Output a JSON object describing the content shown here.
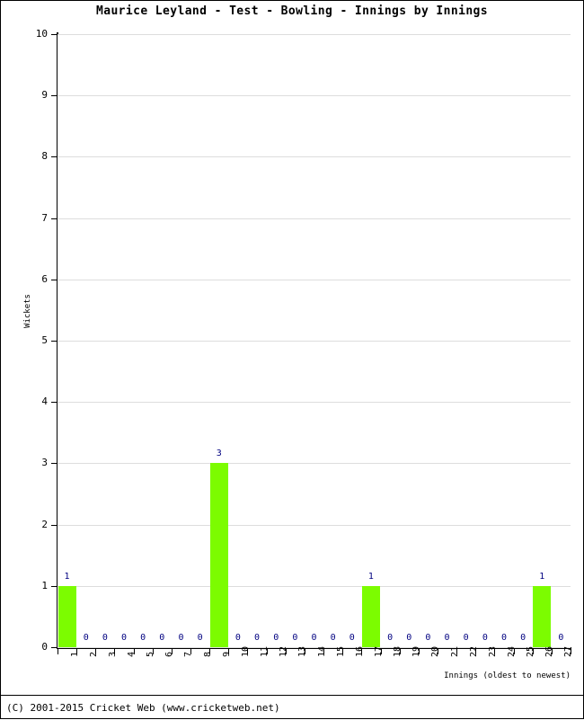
{
  "chart_data": {
    "type": "bar",
    "title": "Maurice Leyland - Test - Bowling - Innings by Innings",
    "xlabel": "Innings (oldest to newest)",
    "ylabel": "Wickets",
    "categories": [
      "1",
      "2",
      "3",
      "4",
      "5",
      "6",
      "7",
      "8",
      "9",
      "10",
      "11",
      "12",
      "13",
      "14",
      "15",
      "16",
      "17",
      "18",
      "19",
      "20",
      "21",
      "22",
      "23",
      "24",
      "25",
      "26",
      "27"
    ],
    "values": [
      1,
      0,
      0,
      0,
      0,
      0,
      0,
      0,
      3,
      0,
      0,
      0,
      0,
      0,
      0,
      0,
      1,
      0,
      0,
      0,
      0,
      0,
      0,
      0,
      0,
      1,
      0
    ],
    "point_labels": [
      "1",
      "0",
      "0",
      "0",
      "0",
      "0",
      "0",
      "0",
      "3",
      "0",
      "0",
      "0",
      "0",
      "0",
      "0",
      "0",
      "1",
      "0",
      "0",
      "0",
      "0",
      "0",
      "0",
      "0",
      "0",
      "1",
      "0"
    ],
    "ylim": [
      0,
      10
    ],
    "yticks": [
      0,
      1,
      2,
      3,
      4,
      5,
      6,
      7,
      8,
      9,
      10
    ],
    "ytick_labels": [
      "0",
      "1",
      "2",
      "3",
      "4",
      "5",
      "6",
      "7",
      "8",
      "9",
      "10"
    ],
    "grid": true,
    "legend": false,
    "bar_color": "#7cfc00",
    "label_color": "#000080",
    "grid_color": "#dddddd",
    "axis_color": "#000000"
  },
  "footer": {
    "copyright": "(C) 2001-2015 Cricket Web (www.cricketweb.net)"
  }
}
